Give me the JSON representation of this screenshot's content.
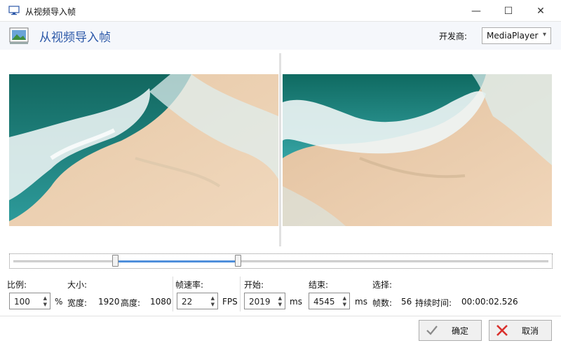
{
  "window": {
    "title": "从视频导入帧",
    "minimize_glyph": "—",
    "maximize_glyph": "☐",
    "close_glyph": "✕"
  },
  "header": {
    "title": "从视频导入帧",
    "vendor_label": "开发商:",
    "vendor_value": "MediaPlayer"
  },
  "slider": {
    "start_fraction": 0.19,
    "end_fraction": 0.42
  },
  "params": {
    "scale_label": "比例:",
    "scale_value": "100",
    "scale_unit": "%",
    "size_label": "大小:",
    "width_label": "宽度:",
    "width_value": "1920",
    "height_label": "高度:",
    "height_value": "1080",
    "fps_label": "帧速率:",
    "fps_value": "22",
    "fps_unit": "FPS",
    "start_label": "开始:",
    "start_value": "2019",
    "start_unit": "ms",
    "end_label": "结束:",
    "end_value": "4545",
    "end_unit": "ms",
    "selection_label": "选择:",
    "frames_label": "帧数:",
    "frames_value": "56",
    "duration_label": "持续时间:",
    "duration_value": "00:00:02.526"
  },
  "buttons": {
    "ok": "确定",
    "cancel": "取消"
  },
  "colors": {
    "accent": "#2c58a8",
    "slider_range": "#4f8fdb",
    "ok_check": "#8a8a8a",
    "cancel_x": "#d9302c"
  }
}
